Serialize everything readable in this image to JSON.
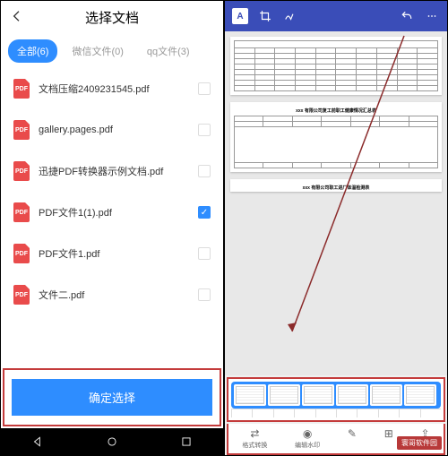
{
  "left": {
    "title": "选择文档",
    "tabs": [
      {
        "label": "全部(6)",
        "active": true
      },
      {
        "label": "微信文件(0)",
        "active": false
      },
      {
        "label": "qq文件(3)",
        "active": false
      }
    ],
    "files": [
      {
        "name": "文档压缩2409231545.pdf",
        "checked": false
      },
      {
        "name": "gallery.pages.pdf",
        "checked": false
      },
      {
        "name": "迅捷PDF转换器示例文档.pdf",
        "checked": false
      },
      {
        "name": "PDF文件1(1).pdf",
        "checked": true
      },
      {
        "name": "PDF文件1.pdf",
        "checked": false
      },
      {
        "name": "文件二.pdf",
        "checked": false
      }
    ],
    "confirm": "确定选择",
    "pdf_badge": "PDF"
  },
  "right": {
    "toolbar": {
      "text_icon": "A"
    },
    "page_titles": [
      "xxx 有限公司复工前职工健康情况汇总表",
      "xxx 有限公司职工进厂体温检测表"
    ],
    "bottom_menu": [
      {
        "label": "格式转换"
      },
      {
        "label": "编辑水印"
      },
      {
        "label": ""
      },
      {
        "label": ""
      },
      {
        "label": ""
      }
    ],
    "watermark": "寰哥软件园"
  }
}
